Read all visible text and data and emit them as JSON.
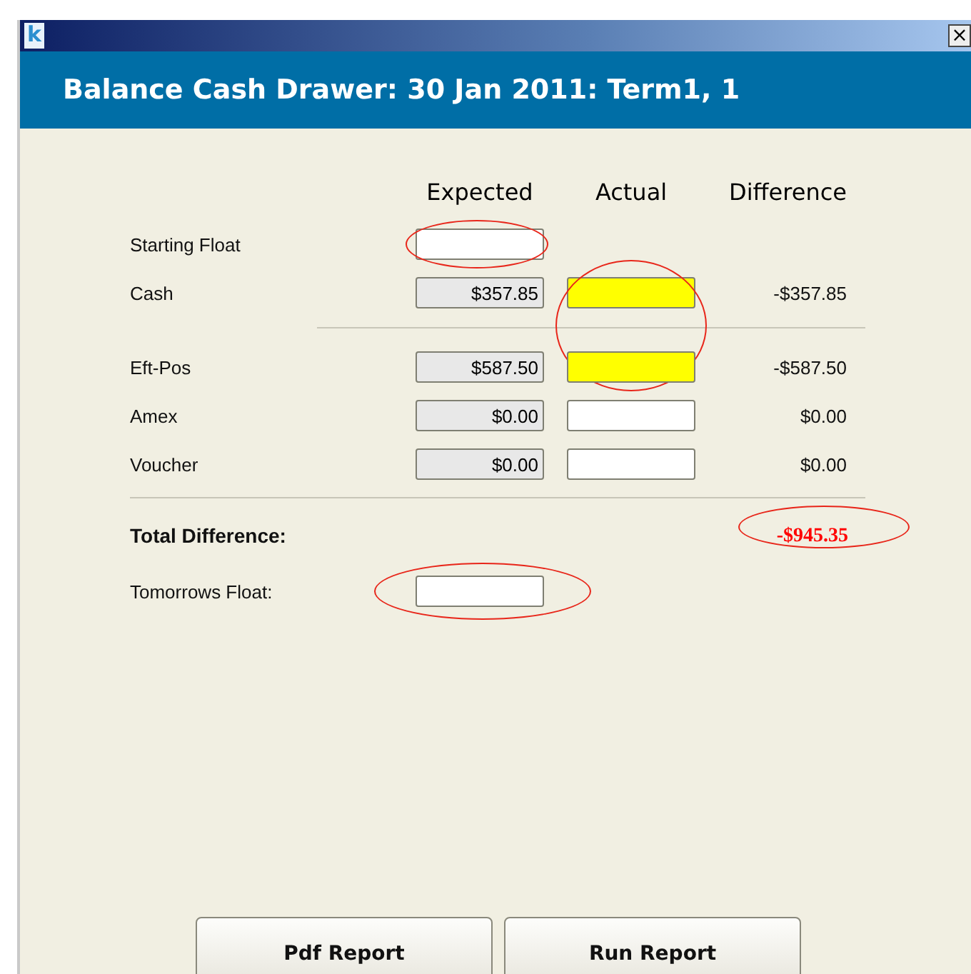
{
  "window": {
    "title": "Balance Cash Drawer: 30 Jan 2011: Term1, 1",
    "close_label": "×",
    "app_icon_letter": "k"
  },
  "columns": [
    "Expected",
    "Actual",
    "Difference"
  ],
  "rows": [
    {
      "label": "Starting Float",
      "expected": {
        "readonly": false,
        "circled": true
      },
      "divider_after": false
    },
    {
      "label": "Cash",
      "expected": {
        "value": "$357.85",
        "readonly": true
      },
      "actual": {
        "highlighted": true,
        "circled_with_next_row": true
      },
      "difference": "-$357.85",
      "divider_after": true
    },
    {
      "label": "Eft-Pos",
      "expected": {
        "value": "$587.50",
        "readonly": true
      },
      "actual": {
        "highlighted": true
      },
      "difference": "-$587.50",
      "divider_after": false
    },
    {
      "label": "Amex",
      "expected": {
        "value": "$0.00",
        "readonly": true
      },
      "actual": {
        "highlighted": false
      },
      "difference": "$0.00",
      "divider_after": false
    },
    {
      "label": "Voucher",
      "expected": {
        "value": "$0.00",
        "readonly": true
      },
      "actual": {
        "highlighted": false
      },
      "difference": "$0.00",
      "divider_after": false
    }
  ],
  "total": {
    "label": "Total Difference:",
    "value": "-$945.35",
    "circled": true
  },
  "tomorrow": {
    "label": "Tomorrows Float:",
    "circled": true
  },
  "buttons": [
    "Pdf Report",
    "Run Report"
  ]
}
